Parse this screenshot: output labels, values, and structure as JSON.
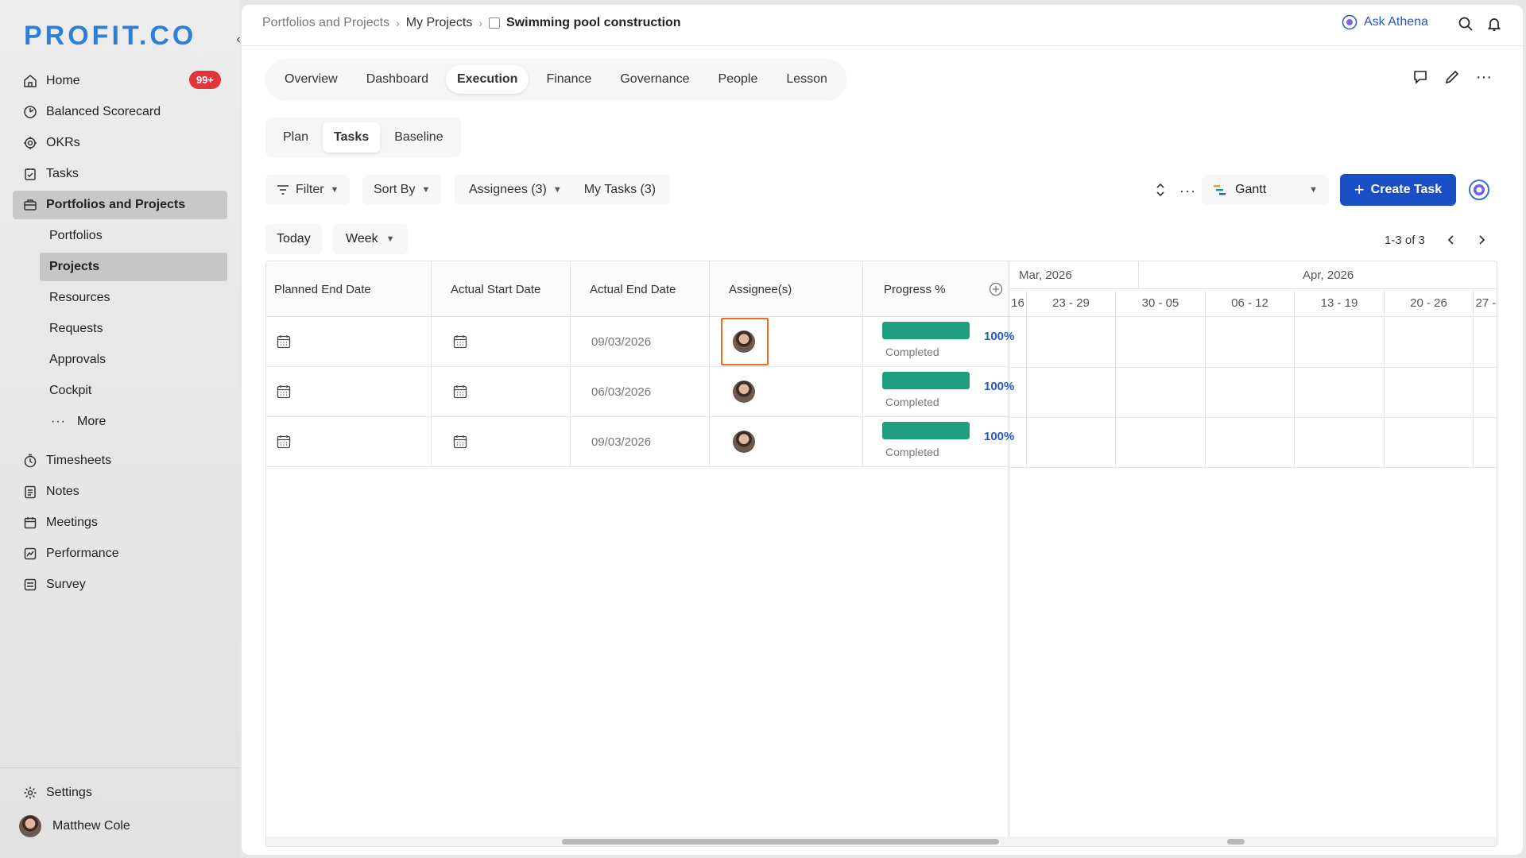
{
  "logo": "PROFIT.CO",
  "sidebar": {
    "items": [
      {
        "label": "Home",
        "icon": "home-icon",
        "badge": "99+"
      },
      {
        "label": "Balanced Scorecard",
        "icon": "scorecard-icon"
      },
      {
        "label": "OKRs",
        "icon": "target-icon"
      },
      {
        "label": "Tasks",
        "icon": "tasks-icon"
      },
      {
        "label": "Portfolios and Projects",
        "icon": "briefcase-icon"
      }
    ],
    "sub_items": [
      "Portfolios",
      "Projects",
      "Resources",
      "Requests",
      "Approvals",
      "Cockpit",
      "More"
    ],
    "items2": [
      {
        "label": "Timesheets",
        "icon": "timer-icon"
      },
      {
        "label": "Notes",
        "icon": "notes-icon"
      },
      {
        "label": "Meetings",
        "icon": "calendar-icon"
      },
      {
        "label": "Performance",
        "icon": "chart-icon"
      },
      {
        "label": "Survey",
        "icon": "survey-icon"
      }
    ],
    "settings": "Settings",
    "user": "Matthew Cole"
  },
  "breadcrumb": {
    "items": [
      "Portfolios and Projects",
      "My Projects"
    ],
    "current": "Swimming pool construction"
  },
  "ask_athena": "Ask Athena",
  "tabs": [
    "Overview",
    "Dashboard",
    "Execution",
    "Finance",
    "Governance",
    "People",
    "Lesson"
  ],
  "active_tab": "Execution",
  "subtabs": [
    "Plan",
    "Tasks",
    "Baseline"
  ],
  "active_subtab": "Tasks",
  "toolbar": {
    "filter": "Filter",
    "sort": "Sort By",
    "assignees": "Assignees (3)",
    "my_tasks": "My Tasks (3)",
    "view": "Gantt",
    "create": "Create Task"
  },
  "nav": {
    "today": "Today",
    "week": "Week",
    "pager": "1-3 of 3"
  },
  "table": {
    "headers": [
      "Planned End Date",
      "Actual Start Date",
      "Actual End Date",
      "Assignee(s)",
      "Progress %"
    ],
    "rows": [
      {
        "actual_end": "09/03/2026",
        "progress": 100,
        "progress_label": "100%",
        "status": "Completed"
      },
      {
        "actual_end": "06/03/2026",
        "progress": 100,
        "progress_label": "100%",
        "status": "Completed"
      },
      {
        "actual_end": "09/03/2026",
        "progress": 100,
        "progress_label": "100%",
        "status": "Completed"
      }
    ]
  },
  "gantt": {
    "months": [
      "Mar, 2026",
      "Apr, 2026"
    ],
    "weeks": [
      "16",
      "23 - 29",
      "30 - 05",
      "06 - 12",
      "13 - 19",
      "20 - 26",
      "27 -"
    ]
  },
  "colors": {
    "accent": "#1a4fc4",
    "progress": "#1e9e7c",
    "badge": "#e3343e",
    "highlight": "#f26a21"
  }
}
